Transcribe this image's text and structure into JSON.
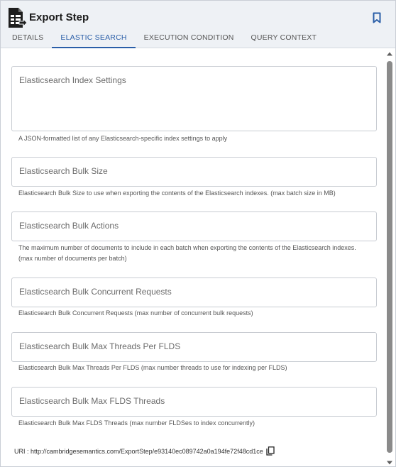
{
  "header": {
    "title": "Export Step"
  },
  "tabs": [
    {
      "label": "DETAILS"
    },
    {
      "label": "ELASTIC SEARCH"
    },
    {
      "label": "EXECUTION CONDITION"
    },
    {
      "label": "QUERY CONTEXT"
    }
  ],
  "fields": [
    {
      "label": "Elasticsearch Index Settings",
      "help": "A JSON-formatted list of any Elasticsearch-specific index settings to apply"
    },
    {
      "label": "Elasticsearch Bulk Size",
      "help": "Elasticsearch Bulk Size to use when exporting the contents of the Elasticsearch indexes. (max batch size in MB)"
    },
    {
      "label": "Elasticsearch Bulk Actions",
      "help": "The maximum number of documents to include in each batch when exporting the contents of the Elasticsearch indexes.(max number of documents per batch)"
    },
    {
      "label": "Elasticsearch Bulk Concurrent Requests",
      "help": "Elasticsearch Bulk Concurrent Requests (max number of concurrent bulk requests)"
    },
    {
      "label": "Elasticsearch Bulk Max Threads Per FLDS",
      "help": "Elasticsearch Bulk Max Threads Per FLDS (max number threads to use for indexing per FLDS)"
    },
    {
      "label": "Elasticsearch Bulk Max FLDS Threads",
      "help": "Elasticsearch Bulk Max FLDS Threads (max number FLDSes to index concurrently)"
    }
  ],
  "uri": {
    "text": "URI : http://cambridgesemantics.com/ExportStep/e93140ec089742a0a194fe72f48cd1ce"
  },
  "colors": {
    "accent": "#2a5ea8",
    "header_bg": "#eef1f5"
  },
  "icons": {
    "step": "export-step-icon",
    "bookmark": "bookmark-icon",
    "copy": "copy-icon"
  }
}
